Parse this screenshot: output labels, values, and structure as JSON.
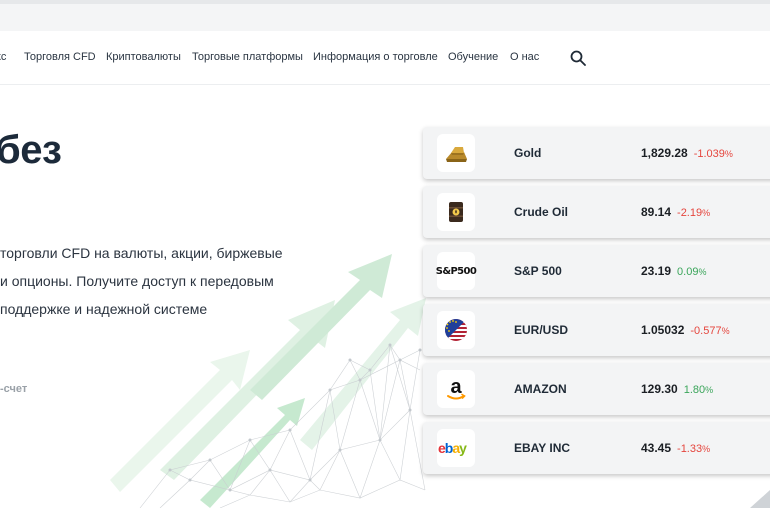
{
  "nav": {
    "items": [
      "кс",
      "Торговля CFD",
      "Криптовалюты",
      "Торговые платформы",
      "Информация о торговле",
      "Обучение",
      "О нас"
    ]
  },
  "hero": {
    "title": "без",
    "desc_lines": [
      "торговли CFD на валюты, акции, биржевые",
      "и опционы. Получите доступ к передовым",
      "поддержке и надежной системе"
    ],
    "demo_link": "-счет"
  },
  "quotes": [
    {
      "logo": "gold-bars-icon",
      "name": "Gold",
      "price": "1,829.28",
      "change": "-1.039",
      "direction": "neg"
    },
    {
      "logo": "oil-barrel-icon",
      "name": "Crude Oil",
      "price": "89.14",
      "change": "-2.19",
      "direction": "neg"
    },
    {
      "logo": "sp500-logo",
      "logo_text": "S&P500",
      "name": "S&P 500",
      "price": "23.19",
      "change": "0.09",
      "direction": "pos"
    },
    {
      "logo": "eur-usd-flag-icon",
      "name": "EUR/USD",
      "price": "1.05032",
      "change": "-0.577",
      "direction": "neg"
    },
    {
      "logo": "amazon-logo",
      "logo_text": "a",
      "name": "AMAZON",
      "price": "129.30",
      "change": "1.80",
      "direction": "pos"
    },
    {
      "logo": "ebay-logo",
      "logo_text": "ebay",
      "name": "EBAY INC",
      "price": "43.45",
      "change": "-1.33",
      "direction": "neg"
    }
  ],
  "colors": {
    "negative": "#e5453d",
    "positive": "#3aa55a",
    "accent_green": "#8fd39a"
  }
}
